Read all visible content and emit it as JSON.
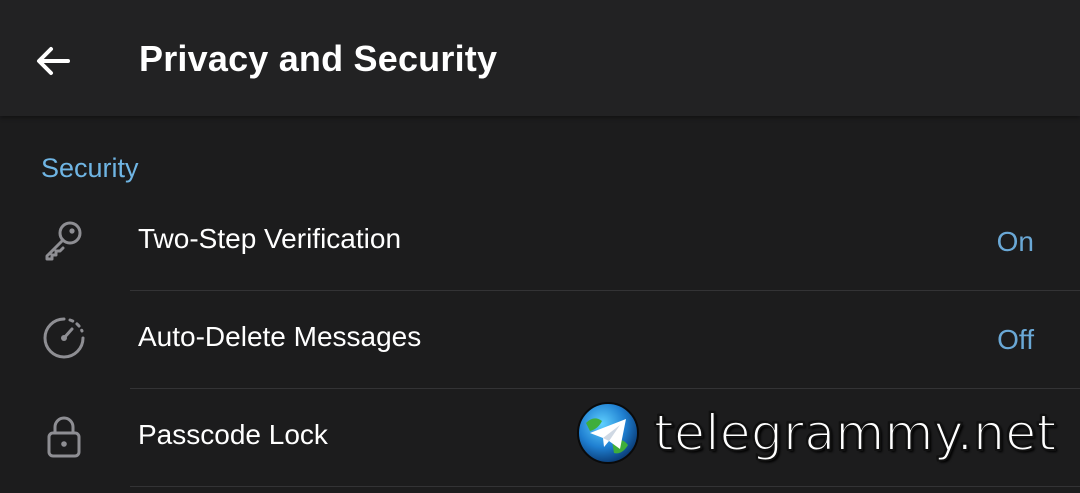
{
  "appbar": {
    "title": "Privacy and Security",
    "back_icon": "arrow-left-icon"
  },
  "section": {
    "title": "Security",
    "color": "#6fb5e4"
  },
  "rows": [
    {
      "icon": "key-icon",
      "label": "Two-Step Verification",
      "value": "On"
    },
    {
      "icon": "auto-delete-timer-icon",
      "label": "Auto-Delete Messages",
      "value": "Off"
    },
    {
      "icon": "lock-icon",
      "label": "Passcode Lock",
      "value": ""
    }
  ],
  "watermark": {
    "text": "telegrammy.net",
    "logo_icon": "telegram-globe-logo-icon"
  },
  "colors": {
    "background": "#1c1c1d",
    "appbar": "#222223",
    "accent_value": "#6aa8d6",
    "text": "#ffffff"
  }
}
